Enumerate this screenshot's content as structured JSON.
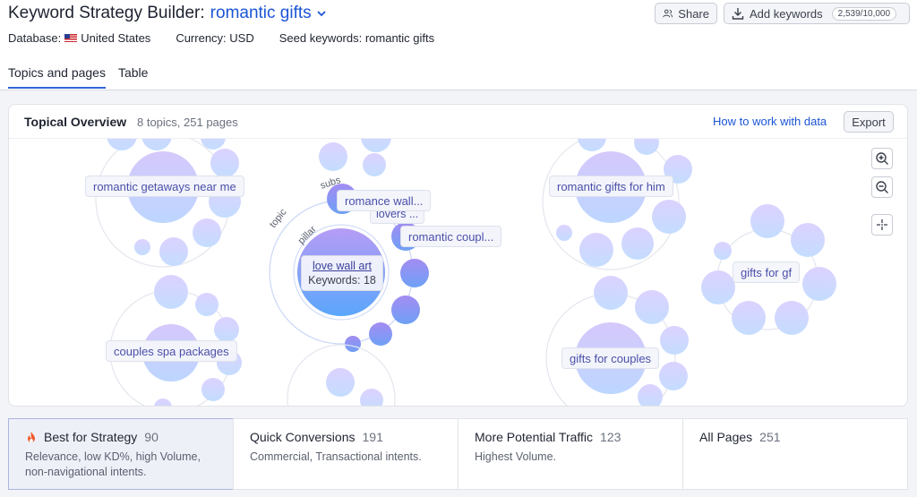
{
  "header": {
    "title": "Keyword Strategy Builder:",
    "project": "romantic gifts",
    "share_label": "Share",
    "add_keywords_label": "Add keywords",
    "keyword_usage": "2,539/10,000"
  },
  "meta": {
    "database_label": "Database:",
    "database_value": "United States",
    "currency": "Currency: USD",
    "seed": "Seed keywords: romantic gifts"
  },
  "tabs": [
    {
      "label": "Topics and pages",
      "active": true
    },
    {
      "label": "Table",
      "active": false
    }
  ],
  "overview": {
    "title": "Topical Overview",
    "summary": "8 topics, 251 pages",
    "how_link": "How to work with data",
    "export_label": "Export",
    "arc_labels": {
      "topic": "topic",
      "pillar": "pillar",
      "subs": "subs"
    },
    "pillar_page": "love wall art",
    "pillar_keywords": "Keywords: 18",
    "sub_labels": [
      "romance wall...",
      "lovers ...",
      "romantic coupl..."
    ],
    "topics": [
      "romantic getaways near me",
      "couples spa packages",
      "romantic gifts for him",
      "gifts for gf",
      "gifts for couples"
    ]
  },
  "strategies": [
    {
      "title": "Best for Strategy",
      "count": "90",
      "desc": [
        "Relevance, low KD%, high Volume,",
        "non-navigational intents."
      ],
      "selected": true
    },
    {
      "title": "Quick Conversions",
      "count": "191",
      "desc": [
        "Commercial, Transactional intents."
      ],
      "selected": false
    },
    {
      "title": "More Potential Traffic",
      "count": "123",
      "desc": [
        "Highest Volume."
      ],
      "selected": false
    },
    {
      "title": "All Pages",
      "count": "251",
      "desc": [],
      "selected": false
    }
  ],
  "colors": {
    "accent": "#1b55d6",
    "bubble_light": "#dfe3ff",
    "bubble_mid": "#b9b6fb",
    "tab_underline": "#3565d6"
  },
  "icons": {
    "chevron": "chevron-down-icon",
    "share": "users-icon",
    "add": "download-icon",
    "zoom_in": "zoom-in-icon",
    "zoom_out": "zoom-out-icon",
    "center": "crosshair-icon",
    "fire": "fire-icon"
  }
}
